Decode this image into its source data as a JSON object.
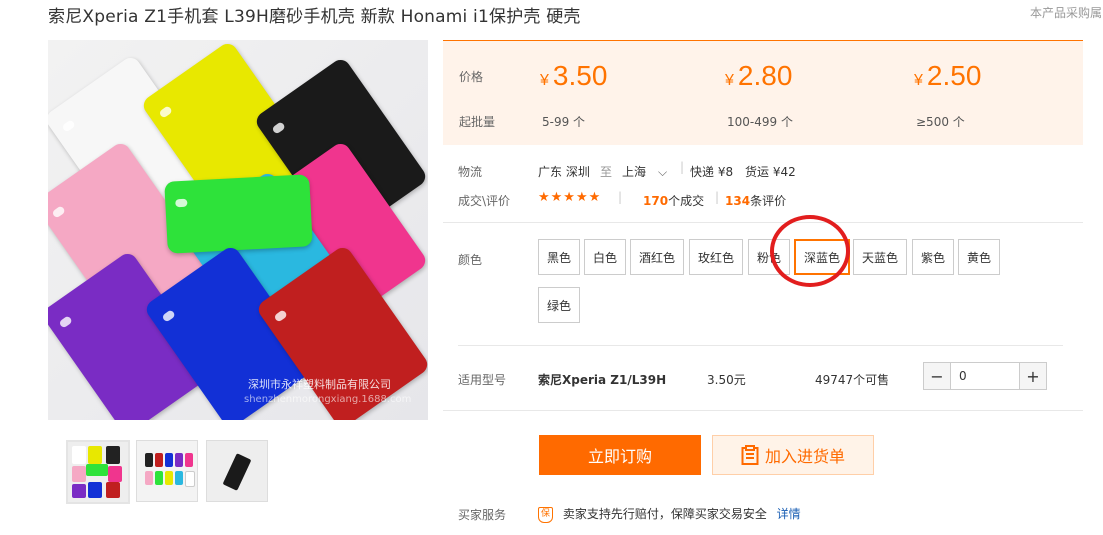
{
  "product": {
    "title": "索尼Xperia Z1手机套 L39H磨砂手机壳 新款 Honami i1保护壳 硬壳",
    "note": "本产品采购属",
    "watermark": "深圳市永祥塑料制品有限公司",
    "watermark_sub": "shenzhenmorongxiang.1688.com"
  },
  "pricing": {
    "price_label": "价格",
    "moq_label": "起批量",
    "currency": "¥",
    "tiers": [
      {
        "price": "3.50",
        "qty": "5-99 个"
      },
      {
        "price": "2.80",
        "qty": "100-499 个"
      },
      {
        "price": "2.50",
        "qty": "≥500 个"
      }
    ]
  },
  "logistics": {
    "label": "物流",
    "from": "广东 深圳",
    "to_word": "至",
    "dest": "上海",
    "express": "快递 ¥8",
    "freight": "货运 ¥42"
  },
  "reviews": {
    "label": "成交\\评价",
    "stars": "★★★★★",
    "deals_count": "170",
    "deals_suffix": "个成交",
    "review_count": "134",
    "review_suffix": "条评价"
  },
  "colors": {
    "label": "颜色",
    "options": [
      "黑色",
      "白色",
      "酒红色",
      "玫红色",
      "粉色",
      "深蓝色",
      "天蓝色",
      "紫色",
      "黄色",
      "绿色"
    ],
    "selected": "深蓝色"
  },
  "model": {
    "label": "适用型号",
    "name": "索尼Xperia Z1/L39H",
    "price": "3.50元",
    "stock": "49747个可售",
    "quantity": "0",
    "minus": "−",
    "plus": "+"
  },
  "actions": {
    "buy": "立即订购",
    "cart": "加入进货单"
  },
  "service": {
    "label": "买家服务",
    "badge": "保",
    "text": "卖家支持先行赔付，保障买家交易安全",
    "link": "详情"
  },
  "accent_color": "#ff6a00"
}
